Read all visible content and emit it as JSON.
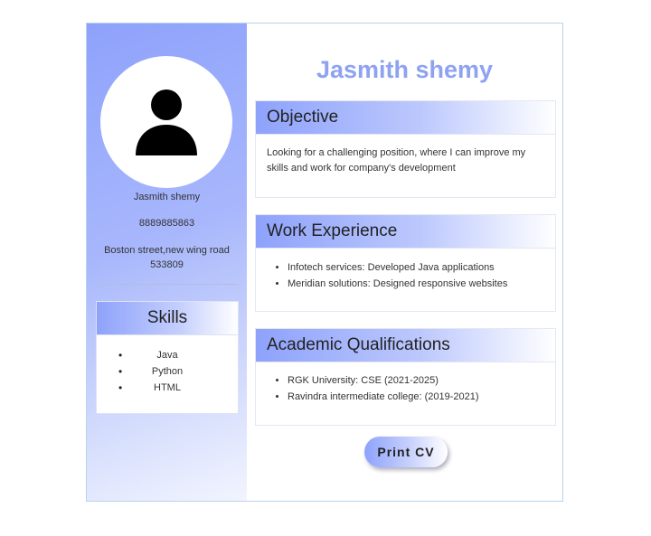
{
  "profile": {
    "avatar_icon": "user-silhouette-icon",
    "name": "Jasmith shemy",
    "phone": "8889885863",
    "address": "Boston street,new wing road 533809"
  },
  "skills": {
    "heading": "Skills",
    "items": [
      "Java",
      "Python",
      "HTML"
    ]
  },
  "main": {
    "title": "Jasmith shemy",
    "objective": {
      "heading": "Objective",
      "text": "Looking for a challenging position, where I can improve my skills and work for company's development"
    },
    "work_experience": {
      "heading": "Work Experience",
      "items": [
        "Infotech services: Developed Java applications",
        "Meridian solutions: Designed responsive websites"
      ]
    },
    "academic": {
      "heading": "Academic Qualifications",
      "items": [
        "RGK University: CSE (2021-2025)",
        "Ravindra intermediate college: (2019-2021)"
      ]
    },
    "print_label": "Print CV"
  },
  "colors": {
    "accent": "#8ea2fb",
    "title": "#8ea2f2"
  }
}
